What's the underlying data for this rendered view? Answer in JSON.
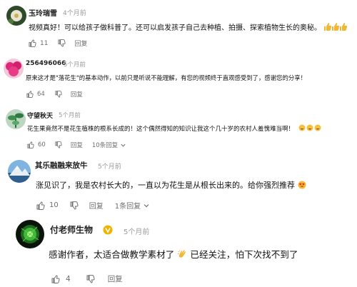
{
  "comments": [
    {
      "name": "玉玲瑞雪",
      "time": "4个月前",
      "text": "视频真好！可以给孩子做科普了。还可以启发孩子自己去种植、拍摄、探索植物生长的奥秘。",
      "emoji_icon": "thumbs-up-icon",
      "emoji_count": 3,
      "likes": "11",
      "reply_label": "回复",
      "avatar_icon": "flower-avatar-icon",
      "accent": "#f2b632"
    },
    {
      "name": "256496066",
      "time": "5个月前",
      "text": "原来这才是\"落花生\"的基本动作，以前只是听说不能理解，有您的视频终于直观感受到了，感谢您的分享！",
      "likes": "64",
      "reply_label": "回复",
      "avatar_icon": "pink-flower-avatar-icon",
      "accent": "#e0287a"
    },
    {
      "name": "守望秋天",
      "time": "5个月前",
      "text": "花生果竟然不是花生植株的根系长成的！这个偶然得知的知识让我这个几十岁的农村人羞愧难当啊！",
      "emoji_icon": "laughing-face-icon",
      "emoji_count": 3,
      "likes": "60",
      "reply_label": "回复",
      "thread_label": "10条回复",
      "avatar_icon": "plant-avatar-icon",
      "accent": "#e0a020"
    },
    {
      "name": "其乐融融来放牛",
      "time": "5个月前",
      "text": "涨见识了，我是农村长大的，一直以为花生是从根长出来的。给你强烈推荐",
      "emoji_icon": "heart-eyes-face-icon",
      "likes": "10",
      "reply_label": "回复",
      "thread_label": "1条回复",
      "avatar_icon": "mountain-avatar-icon",
      "accent": "#f59a23"
    },
    {
      "name": "付老师生物",
      "time": "5个月前",
      "text_before": "感谢作者，太适合做教学素材了",
      "text_after": "已经关注，怕下次找不到了",
      "emoji_icon": "clapping-hands-icon",
      "likes": "4",
      "reply_label": "回复",
      "badge_icon": "verified-v-badge-icon",
      "avatar_icon": "green-cell-avatar-icon",
      "accent": "#f0b400"
    }
  ]
}
